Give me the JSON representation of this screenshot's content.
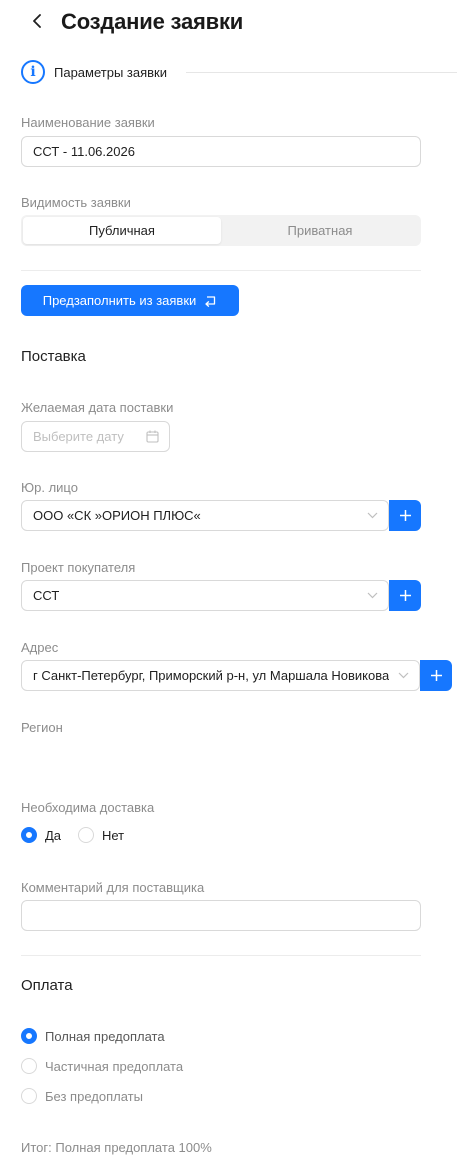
{
  "header": {
    "title": "Создание заявки"
  },
  "section": {
    "label": "Параметры заявки"
  },
  "name_field": {
    "label": "Наименование заявки",
    "value": "ССТ - 11.06.2026"
  },
  "visibility": {
    "label": "Видимость заявки",
    "options": [
      "Публичная",
      "Приватная"
    ],
    "selected": "Публичная"
  },
  "prefill_button": {
    "label": "Предзаполнить из заявки"
  },
  "delivery": {
    "heading": "Поставка",
    "date_label": "Желаемая дата поставки",
    "date_placeholder": "Выберите дату",
    "entity_label": "Юр. лицо",
    "entity_value": "ООО «СК »ОРИОН ПЛЮС«",
    "project_label": "Проект покупателя",
    "project_value": "ССТ",
    "address_label": "Адрес",
    "address_value": "г Санкт-Петербург, Приморский р-н, ул Маршала Новикова",
    "region_label": "Регион",
    "need_delivery_label": "Необходима доставка",
    "need_delivery_options": [
      "Да",
      "Нет"
    ],
    "need_delivery_selected": "Да",
    "comment_label": "Комментарий для поставщика",
    "comment_value": ""
  },
  "payment": {
    "heading": "Оплата",
    "options": [
      "Полная предоплата",
      "Частичная предоплата",
      "Без предоплаты"
    ],
    "selected": "Полная предоплата",
    "summary": "Итог: Полная предоплата 100%"
  },
  "colors": {
    "accent": "#1677ff",
    "muted_text": "#8c8c8c",
    "border": "#d9d9d9"
  }
}
